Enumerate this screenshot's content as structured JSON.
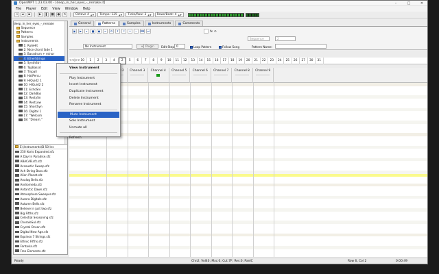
{
  "window": {
    "title": "OpenMPT 1.23.03.00 - [deep_in_her_eyes_-_remake.it]"
  },
  "menu": [
    "File",
    "Player",
    "Edit",
    "View",
    "Window",
    "Help"
  ],
  "toolbar": {
    "octave_label": "Octave 4",
    "tempo_label": "Tempo: 125",
    "ticks_label": "Ticks/Row: 3",
    "rows_beat_label": "Rows/Beat: 4"
  },
  "tree": {
    "header": "deep_in_her_eyes_-_remake",
    "items": [
      "Sequence",
      "Patterns",
      "Samples",
      "Instruments"
    ],
    "instruments": [
      "1: RuleHit",
      "2: Nice chord fade 1",
      "3: Bassdrum + minor",
      "4: EtherStrings",
      "5: SynthStri",
      "6: TapBassd",
      "7: Tinpall",
      "8: HatPercu",
      "9: HiQuid2 1",
      "10: HiQuid2 2",
      "11: EchoSni",
      "12: DarkBas",
      "13: RestySn",
      "14: RestLow",
      "15: ShortSyn",
      "16: Digital 1",
      "17: \"Welcom",
      "18: \"Dream.\""
    ]
  },
  "browser": {
    "path": "E:\\Instruments\\D 50 Ins",
    "files": [
      "250 Korts Expanded.sfz",
      "A Day In Paradise.sfz",
      "ABACAB.sfz.sfz",
      "Accoustic Sweep.sfz",
      "Ach String Bass.sfz",
      "Alien Planet.sfz",
      "Analog Bells.sfz",
      "Andromeda.sfz",
      "Antarctic Dawn.sfz",
      "Atmosphere Sweeper.sfz",
      "Aurora Digitals.sfz",
      "Autumn Bells.sfz",
      "Believe in just two.sfz",
      "Big Fifths.sfz",
      "Celestial Seasoning.sfz",
      "ChoraleSul.sfz",
      "Crystal Ocean.sfz",
      "Digital New Age.sfz",
      "Equinox 7 Strings.sfz",
      "Ethnic Fifths.sfz",
      "Fantasia.sfz",
      "Free Elements.sfz"
    ]
  },
  "tabs": [
    "General",
    "Patterns",
    "Samples",
    "Instruments",
    "Comments"
  ],
  "pattern_toolbar": {
    "instrument_select": "No Instrument",
    "plugin_label": "Plugin",
    "edit_step_label": "Edit Step",
    "edit_step_value": "0",
    "loop_pattern": "Loop Pattern",
    "follow_song": "Follow Song",
    "pattern_name_label": "Pattern Name:",
    "sequence_label": "Sequence",
    "pattern_number": "2"
  },
  "orderlist": {
    "nav": "<<|>>",
    "orders": [
      "10",
      "1",
      "2",
      "3",
      "4",
      "2",
      "5",
      "6",
      "7",
      "8",
      "9",
      "10",
      "11",
      "12",
      "13",
      "14",
      "15",
      "16",
      "17",
      "18",
      "19",
      "20",
      "21",
      "22",
      "23",
      "24",
      "25",
      "26",
      "27",
      "30",
      "31"
    ],
    "current_index": 5
  },
  "channels": [
    "Channel 2",
    "Channel 3",
    "Channel 4",
    "Channel 5",
    "Channel 6",
    "Channel 7",
    "Channel 8",
    "Channel 9"
  ],
  "context_menu": {
    "items": [
      "View Instrument",
      "Play Instrument",
      "Insert Instrument",
      "Duplicate Instrument",
      "Delete Instrument",
      "Rename Instrument",
      "Mute Instrument",
      "Solo Instrument",
      "Unmute all",
      "Refresh"
    ],
    "hover_index": 6
  },
  "status": {
    "left": "Ready",
    "mid": "Chn2; Vol40; Mxc:0; Cut:7F; Res:0; PanIC",
    "pos": "Row 6, Col 2",
    "time": "0:00:49"
  },
  "colors": {
    "selection": "#2a63c5",
    "highlight_row": "#fafa8c",
    "note_green": "#1f8a1f",
    "instr_blue": "#2a4fb0"
  }
}
